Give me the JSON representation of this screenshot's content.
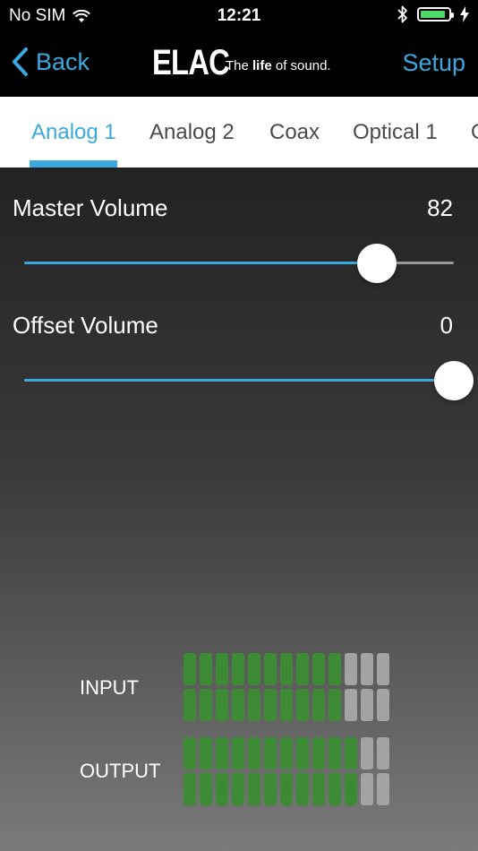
{
  "status_bar": {
    "carrier": "No SIM",
    "time": "12:21",
    "battery_level": 0.9
  },
  "nav": {
    "back_label": "Back",
    "brand": "ELAC",
    "tagline_pre": "The ",
    "tagline_bold": "life",
    "tagline_post": " of sound.",
    "setup_label": "Setup"
  },
  "tabs": [
    {
      "label": "Analog 1",
      "active": true
    },
    {
      "label": "Analog 2",
      "active": false
    },
    {
      "label": "Coax",
      "active": false
    },
    {
      "label": "Optical 1",
      "active": false
    },
    {
      "label": "O",
      "active": false
    }
  ],
  "master_volume": {
    "label": "Master Volume",
    "value": "82",
    "level": 0.82
  },
  "offset_volume": {
    "label": "Offset Volume",
    "value": "0",
    "level": 1.0
  },
  "meters": {
    "input": {
      "label": "INPUT",
      "rows": [
        {
          "lit": 10,
          "total": 13
        },
        {
          "lit": 10,
          "total": 13
        }
      ]
    },
    "output": {
      "label": "OUTPUT",
      "rows": [
        {
          "lit": 11,
          "total": 13
        },
        {
          "lit": 11,
          "total": 13
        }
      ]
    }
  },
  "colors": {
    "accent": "#3aa9e0",
    "meter_on": "#3d8c35",
    "meter_off": "#a3a3a3",
    "battery": "#4cd964"
  }
}
